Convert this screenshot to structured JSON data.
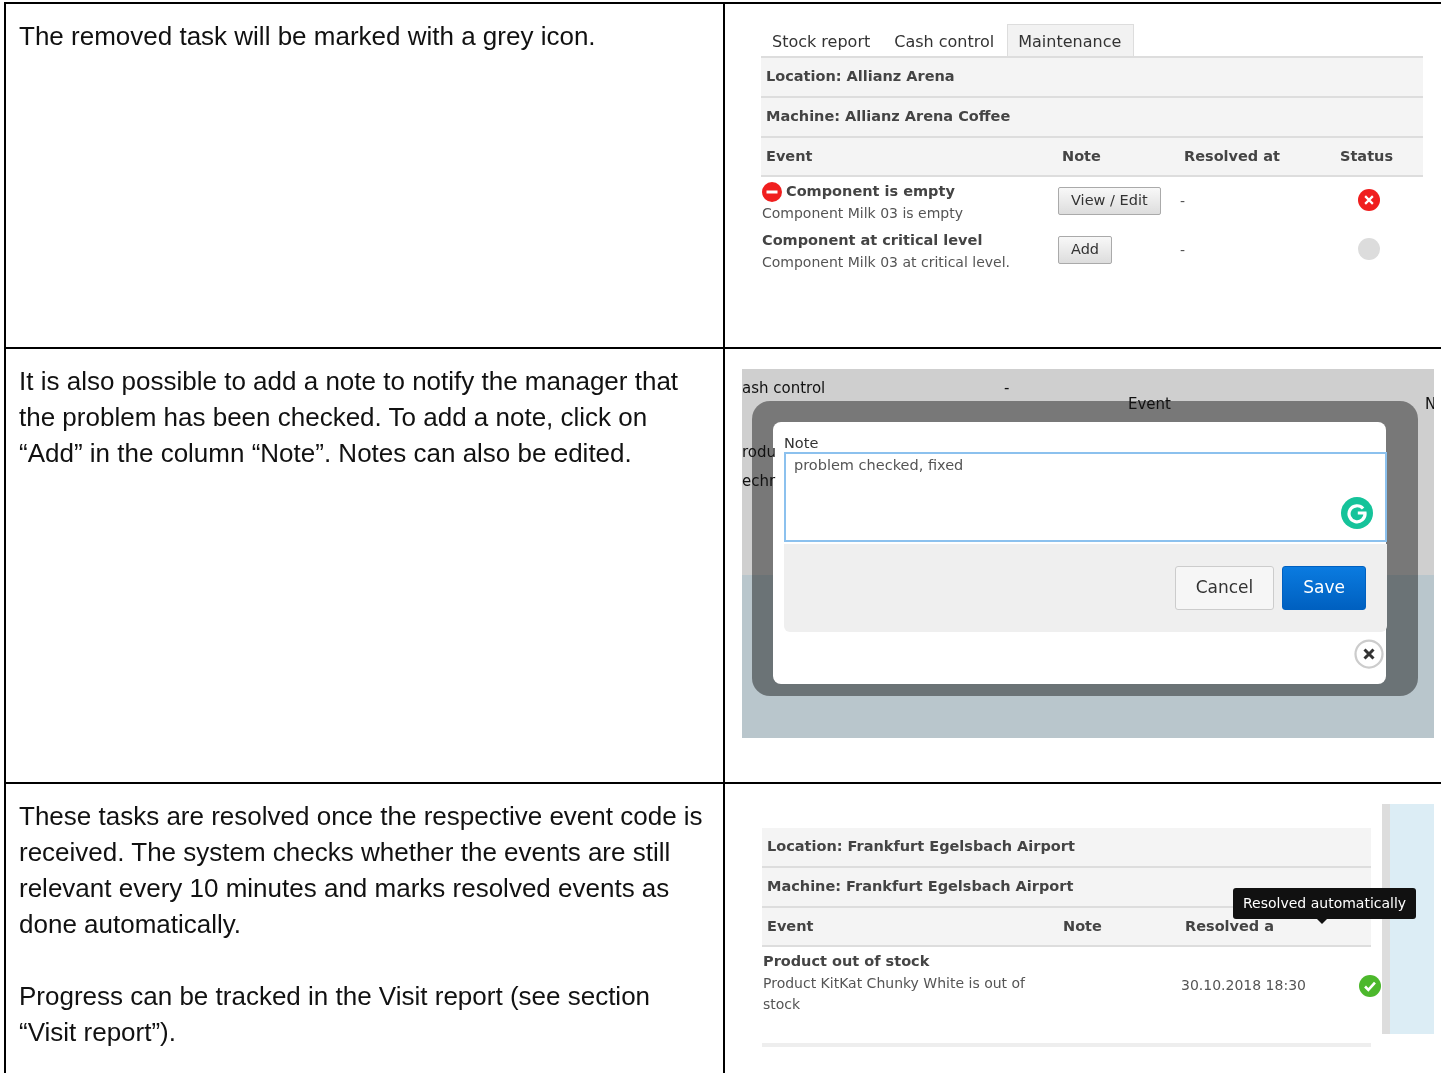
{
  "rows": [
    {
      "paragraphs": [
        "The removed task will be marked with a grey icon."
      ],
      "panel": {
        "kind": "events",
        "tabs": [
          {
            "label": "Stock report",
            "selected": false
          },
          {
            "label": "Cash control",
            "selected": false
          },
          {
            "label": "Maintenance",
            "selected": true
          }
        ],
        "location": "Location: Allianz Arena",
        "machine": "Machine: Allianz Arena Coffee",
        "columns": [
          "Event",
          "Note",
          "Resolved at",
          "Status"
        ],
        "events": [
          {
            "title": "Component is empty",
            "description": "Component Milk 03 is empty",
            "alert": true,
            "note_button": "View / Edit",
            "resolved": "-",
            "kind": "failed"
          },
          {
            "title": "Component at critical level",
            "description": "Component Milk 03 at critical level.",
            "alert": false,
            "note_button": "Add",
            "resolved": "-",
            "kind": "removed"
          }
        ]
      }
    },
    {
      "paragraphs": [
        "It is also possible to add a note to notify the manager that the problem has been checked. To add a note, click on “Add” in the column “Note”. Notes can also be edited."
      ],
      "panel": {
        "kind": "dialog",
        "background_texts": [
          "ash control",
          "-",
          "Event",
          "N",
          "rodu",
          "echr"
        ],
        "label": "Note",
        "value": "problem checked, fixed",
        "buttons": [
          {
            "label": "Cancel",
            "primary": false
          },
          {
            "label": "Save",
            "primary": true
          }
        ]
      }
    },
    {
      "paragraphs": [
        "These tasks are resolved once the respective event code is received. The system checks whether the events are still relevant every 10 minutes and marks resolved events as done automatically.",
        "Progress can be tracked in the Visit report (see section “Visit report”)."
      ],
      "panel": {
        "kind": "events",
        "location": "Location: Frankfurt Egelsbach Airport",
        "machine": "Machine: Frankfurt Egelsbach Airport",
        "columns": [
          "Event",
          "Note",
          "Resolved a"
        ],
        "tooltip": "Resolved automatically",
        "events": [
          {
            "title": "Product out of stock",
            "description": "Product KitKat Chunky White is out of stock",
            "alert": false,
            "resolved": "30.10.2018 18:30",
            "kind": "resolved"
          }
        ]
      }
    }
  ]
}
